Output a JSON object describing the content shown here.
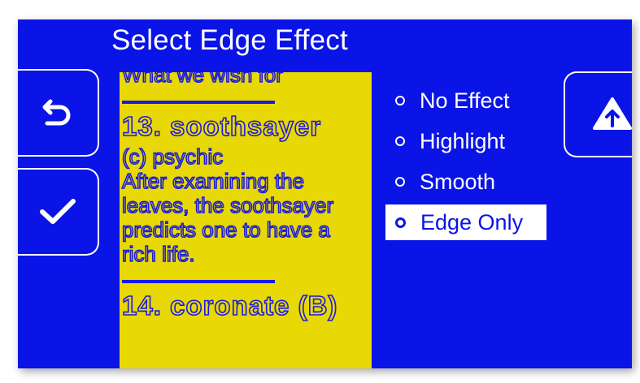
{
  "title": "Select Edge Effect",
  "buttons": {
    "back": "back-icon",
    "confirm": "checkmark-icon",
    "scroll_up": "arrow-up-icon"
  },
  "preview": {
    "lines": [
      "What we wish for",
      "13. soothsayer",
      "(c) psychic",
      "After examining the",
      "leaves, the soothsayer",
      "predicts one to have a",
      "rich life.",
      "14. coronate (B)"
    ]
  },
  "options": [
    {
      "label": "No Effect",
      "selected": false
    },
    {
      "label": "Highlight",
      "selected": false
    },
    {
      "label": "Smooth",
      "selected": false
    },
    {
      "label": "Edge Only",
      "selected": true
    }
  ],
  "colors": {
    "background": "#0a14e6",
    "preview_bg": "#e8d804",
    "text_outline": "#1a1ae0",
    "foreground": "#ffffff"
  }
}
